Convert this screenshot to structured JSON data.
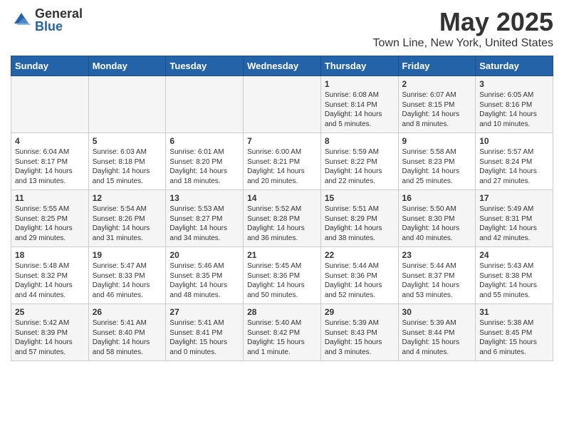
{
  "logo": {
    "general": "General",
    "blue": "Blue"
  },
  "title": "May 2025",
  "subtitle": "Town Line, New York, United States",
  "days_header": [
    "Sunday",
    "Monday",
    "Tuesday",
    "Wednesday",
    "Thursday",
    "Friday",
    "Saturday"
  ],
  "weeks": [
    [
      {
        "day": "",
        "content": ""
      },
      {
        "day": "",
        "content": ""
      },
      {
        "day": "",
        "content": ""
      },
      {
        "day": "",
        "content": ""
      },
      {
        "day": "1",
        "content": "Sunrise: 6:08 AM\nSunset: 8:14 PM\nDaylight: 14 hours\nand 5 minutes."
      },
      {
        "day": "2",
        "content": "Sunrise: 6:07 AM\nSunset: 8:15 PM\nDaylight: 14 hours\nand 8 minutes."
      },
      {
        "day": "3",
        "content": "Sunrise: 6:05 AM\nSunset: 8:16 PM\nDaylight: 14 hours\nand 10 minutes."
      }
    ],
    [
      {
        "day": "4",
        "content": "Sunrise: 6:04 AM\nSunset: 8:17 PM\nDaylight: 14 hours\nand 13 minutes."
      },
      {
        "day": "5",
        "content": "Sunrise: 6:03 AM\nSunset: 8:18 PM\nDaylight: 14 hours\nand 15 minutes."
      },
      {
        "day": "6",
        "content": "Sunrise: 6:01 AM\nSunset: 8:20 PM\nDaylight: 14 hours\nand 18 minutes."
      },
      {
        "day": "7",
        "content": "Sunrise: 6:00 AM\nSunset: 8:21 PM\nDaylight: 14 hours\nand 20 minutes."
      },
      {
        "day": "8",
        "content": "Sunrise: 5:59 AM\nSunset: 8:22 PM\nDaylight: 14 hours\nand 22 minutes."
      },
      {
        "day": "9",
        "content": "Sunrise: 5:58 AM\nSunset: 8:23 PM\nDaylight: 14 hours\nand 25 minutes."
      },
      {
        "day": "10",
        "content": "Sunrise: 5:57 AM\nSunset: 8:24 PM\nDaylight: 14 hours\nand 27 minutes."
      }
    ],
    [
      {
        "day": "11",
        "content": "Sunrise: 5:55 AM\nSunset: 8:25 PM\nDaylight: 14 hours\nand 29 minutes."
      },
      {
        "day": "12",
        "content": "Sunrise: 5:54 AM\nSunset: 8:26 PM\nDaylight: 14 hours\nand 31 minutes."
      },
      {
        "day": "13",
        "content": "Sunrise: 5:53 AM\nSunset: 8:27 PM\nDaylight: 14 hours\nand 34 minutes."
      },
      {
        "day": "14",
        "content": "Sunrise: 5:52 AM\nSunset: 8:28 PM\nDaylight: 14 hours\nand 36 minutes."
      },
      {
        "day": "15",
        "content": "Sunrise: 5:51 AM\nSunset: 8:29 PM\nDaylight: 14 hours\nand 38 minutes."
      },
      {
        "day": "16",
        "content": "Sunrise: 5:50 AM\nSunset: 8:30 PM\nDaylight: 14 hours\nand 40 minutes."
      },
      {
        "day": "17",
        "content": "Sunrise: 5:49 AM\nSunset: 8:31 PM\nDaylight: 14 hours\nand 42 minutes."
      }
    ],
    [
      {
        "day": "18",
        "content": "Sunrise: 5:48 AM\nSunset: 8:32 PM\nDaylight: 14 hours\nand 44 minutes."
      },
      {
        "day": "19",
        "content": "Sunrise: 5:47 AM\nSunset: 8:33 PM\nDaylight: 14 hours\nand 46 minutes."
      },
      {
        "day": "20",
        "content": "Sunrise: 5:46 AM\nSunset: 8:35 PM\nDaylight: 14 hours\nand 48 minutes."
      },
      {
        "day": "21",
        "content": "Sunrise: 5:45 AM\nSunset: 8:36 PM\nDaylight: 14 hours\nand 50 minutes."
      },
      {
        "day": "22",
        "content": "Sunrise: 5:44 AM\nSunset: 8:36 PM\nDaylight: 14 hours\nand 52 minutes."
      },
      {
        "day": "23",
        "content": "Sunrise: 5:44 AM\nSunset: 8:37 PM\nDaylight: 14 hours\nand 53 minutes."
      },
      {
        "day": "24",
        "content": "Sunrise: 5:43 AM\nSunset: 8:38 PM\nDaylight: 14 hours\nand 55 minutes."
      }
    ],
    [
      {
        "day": "25",
        "content": "Sunrise: 5:42 AM\nSunset: 8:39 PM\nDaylight: 14 hours\nand 57 minutes."
      },
      {
        "day": "26",
        "content": "Sunrise: 5:41 AM\nSunset: 8:40 PM\nDaylight: 14 hours\nand 58 minutes."
      },
      {
        "day": "27",
        "content": "Sunrise: 5:41 AM\nSunset: 8:41 PM\nDaylight: 15 hours\nand 0 minutes."
      },
      {
        "day": "28",
        "content": "Sunrise: 5:40 AM\nSunset: 8:42 PM\nDaylight: 15 hours\nand 1 minute."
      },
      {
        "day": "29",
        "content": "Sunrise: 5:39 AM\nSunset: 8:43 PM\nDaylight: 15 hours\nand 3 minutes."
      },
      {
        "day": "30",
        "content": "Sunrise: 5:39 AM\nSunset: 8:44 PM\nDaylight: 15 hours\nand 4 minutes."
      },
      {
        "day": "31",
        "content": "Sunrise: 5:38 AM\nSunset: 8:45 PM\nDaylight: 15 hours\nand 6 minutes."
      }
    ]
  ]
}
